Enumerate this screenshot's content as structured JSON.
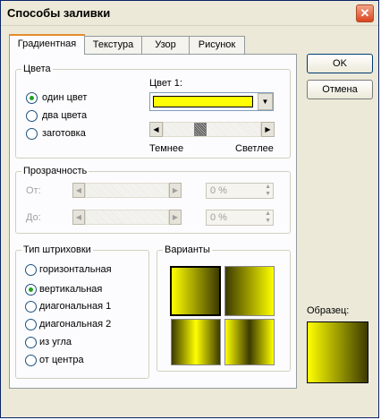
{
  "window": {
    "title": "Способы заливки",
    "close_glyph": "✕"
  },
  "tabs": [
    {
      "label": "Градиентная"
    },
    {
      "label": "Текстура"
    },
    {
      "label": "Узор"
    },
    {
      "label": "Рисунок"
    }
  ],
  "buttons": {
    "ok": "OK",
    "cancel": "Отмена"
  },
  "colors_group": {
    "label": "Цвета",
    "options": [
      "один цвет",
      "два цвета",
      "заготовка"
    ],
    "selected_index": 0,
    "color1_label": "Цвет 1:",
    "color1_value": "#ffff00",
    "slider_left": "Темнее",
    "slider_right": "Светлее",
    "slider_fraction": 0.36
  },
  "transparency_group": {
    "label": "Прозрачность",
    "from_label": "От:",
    "to_label": "До:",
    "from_value": "0 %",
    "to_value": "0 %"
  },
  "hatch_group": {
    "label": "Тип штриховки",
    "options": [
      "горизонтальная",
      "вертикальная",
      "диагональная 1",
      "диагональная 2",
      "из угла",
      "от центра"
    ],
    "selected_index": 1
  },
  "variants_group": {
    "label": "Варианты"
  },
  "sample": {
    "label": "Образец:"
  },
  "palette": {
    "accent": "#ffff00",
    "dark": "#3c3a00",
    "tab_highlight": "#e68b2c"
  },
  "icons": {
    "dropdown": "chevron-down-icon",
    "left": "arrow-left-icon",
    "right": "arrow-right-icon"
  }
}
